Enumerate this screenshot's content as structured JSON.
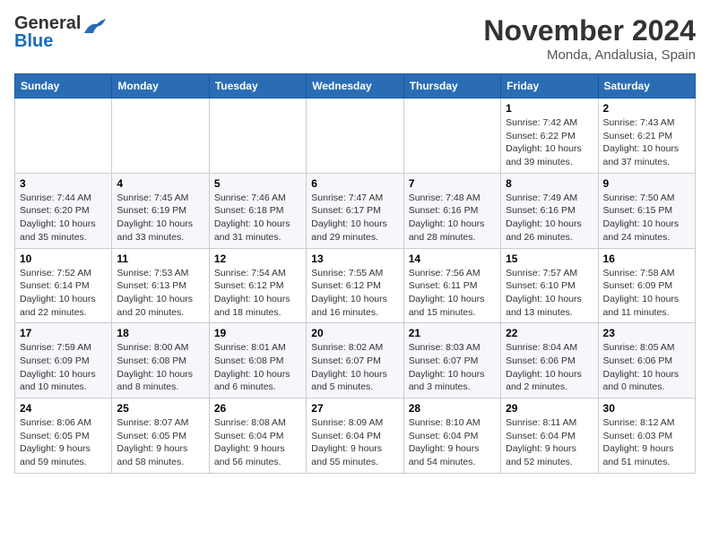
{
  "header": {
    "logo_general": "General",
    "logo_blue": "Blue",
    "month_title": "November 2024",
    "location": "Monda, Andalusia, Spain"
  },
  "days_of_week": [
    "Sunday",
    "Monday",
    "Tuesday",
    "Wednesday",
    "Thursday",
    "Friday",
    "Saturday"
  ],
  "weeks": [
    [
      {
        "day": "",
        "info": ""
      },
      {
        "day": "",
        "info": ""
      },
      {
        "day": "",
        "info": ""
      },
      {
        "day": "",
        "info": ""
      },
      {
        "day": "",
        "info": ""
      },
      {
        "day": "1",
        "info": "Sunrise: 7:42 AM\nSunset: 6:22 PM\nDaylight: 10 hours and 39 minutes."
      },
      {
        "day": "2",
        "info": "Sunrise: 7:43 AM\nSunset: 6:21 PM\nDaylight: 10 hours and 37 minutes."
      }
    ],
    [
      {
        "day": "3",
        "info": "Sunrise: 7:44 AM\nSunset: 6:20 PM\nDaylight: 10 hours and 35 minutes."
      },
      {
        "day": "4",
        "info": "Sunrise: 7:45 AM\nSunset: 6:19 PM\nDaylight: 10 hours and 33 minutes."
      },
      {
        "day": "5",
        "info": "Sunrise: 7:46 AM\nSunset: 6:18 PM\nDaylight: 10 hours and 31 minutes."
      },
      {
        "day": "6",
        "info": "Sunrise: 7:47 AM\nSunset: 6:17 PM\nDaylight: 10 hours and 29 minutes."
      },
      {
        "day": "7",
        "info": "Sunrise: 7:48 AM\nSunset: 6:16 PM\nDaylight: 10 hours and 28 minutes."
      },
      {
        "day": "8",
        "info": "Sunrise: 7:49 AM\nSunset: 6:16 PM\nDaylight: 10 hours and 26 minutes."
      },
      {
        "day": "9",
        "info": "Sunrise: 7:50 AM\nSunset: 6:15 PM\nDaylight: 10 hours and 24 minutes."
      }
    ],
    [
      {
        "day": "10",
        "info": "Sunrise: 7:52 AM\nSunset: 6:14 PM\nDaylight: 10 hours and 22 minutes."
      },
      {
        "day": "11",
        "info": "Sunrise: 7:53 AM\nSunset: 6:13 PM\nDaylight: 10 hours and 20 minutes."
      },
      {
        "day": "12",
        "info": "Sunrise: 7:54 AM\nSunset: 6:12 PM\nDaylight: 10 hours and 18 minutes."
      },
      {
        "day": "13",
        "info": "Sunrise: 7:55 AM\nSunset: 6:12 PM\nDaylight: 10 hours and 16 minutes."
      },
      {
        "day": "14",
        "info": "Sunrise: 7:56 AM\nSunset: 6:11 PM\nDaylight: 10 hours and 15 minutes."
      },
      {
        "day": "15",
        "info": "Sunrise: 7:57 AM\nSunset: 6:10 PM\nDaylight: 10 hours and 13 minutes."
      },
      {
        "day": "16",
        "info": "Sunrise: 7:58 AM\nSunset: 6:09 PM\nDaylight: 10 hours and 11 minutes."
      }
    ],
    [
      {
        "day": "17",
        "info": "Sunrise: 7:59 AM\nSunset: 6:09 PM\nDaylight: 10 hours and 10 minutes."
      },
      {
        "day": "18",
        "info": "Sunrise: 8:00 AM\nSunset: 6:08 PM\nDaylight: 10 hours and 8 minutes."
      },
      {
        "day": "19",
        "info": "Sunrise: 8:01 AM\nSunset: 6:08 PM\nDaylight: 10 hours and 6 minutes."
      },
      {
        "day": "20",
        "info": "Sunrise: 8:02 AM\nSunset: 6:07 PM\nDaylight: 10 hours and 5 minutes."
      },
      {
        "day": "21",
        "info": "Sunrise: 8:03 AM\nSunset: 6:07 PM\nDaylight: 10 hours and 3 minutes."
      },
      {
        "day": "22",
        "info": "Sunrise: 8:04 AM\nSunset: 6:06 PM\nDaylight: 10 hours and 2 minutes."
      },
      {
        "day": "23",
        "info": "Sunrise: 8:05 AM\nSunset: 6:06 PM\nDaylight: 10 hours and 0 minutes."
      }
    ],
    [
      {
        "day": "24",
        "info": "Sunrise: 8:06 AM\nSunset: 6:05 PM\nDaylight: 9 hours and 59 minutes."
      },
      {
        "day": "25",
        "info": "Sunrise: 8:07 AM\nSunset: 6:05 PM\nDaylight: 9 hours and 58 minutes."
      },
      {
        "day": "26",
        "info": "Sunrise: 8:08 AM\nSunset: 6:04 PM\nDaylight: 9 hours and 56 minutes."
      },
      {
        "day": "27",
        "info": "Sunrise: 8:09 AM\nSunset: 6:04 PM\nDaylight: 9 hours and 55 minutes."
      },
      {
        "day": "28",
        "info": "Sunrise: 8:10 AM\nSunset: 6:04 PM\nDaylight: 9 hours and 54 minutes."
      },
      {
        "day": "29",
        "info": "Sunrise: 8:11 AM\nSunset: 6:04 PM\nDaylight: 9 hours and 52 minutes."
      },
      {
        "day": "30",
        "info": "Sunrise: 8:12 AM\nSunset: 6:03 PM\nDaylight: 9 hours and 51 minutes."
      }
    ]
  ]
}
